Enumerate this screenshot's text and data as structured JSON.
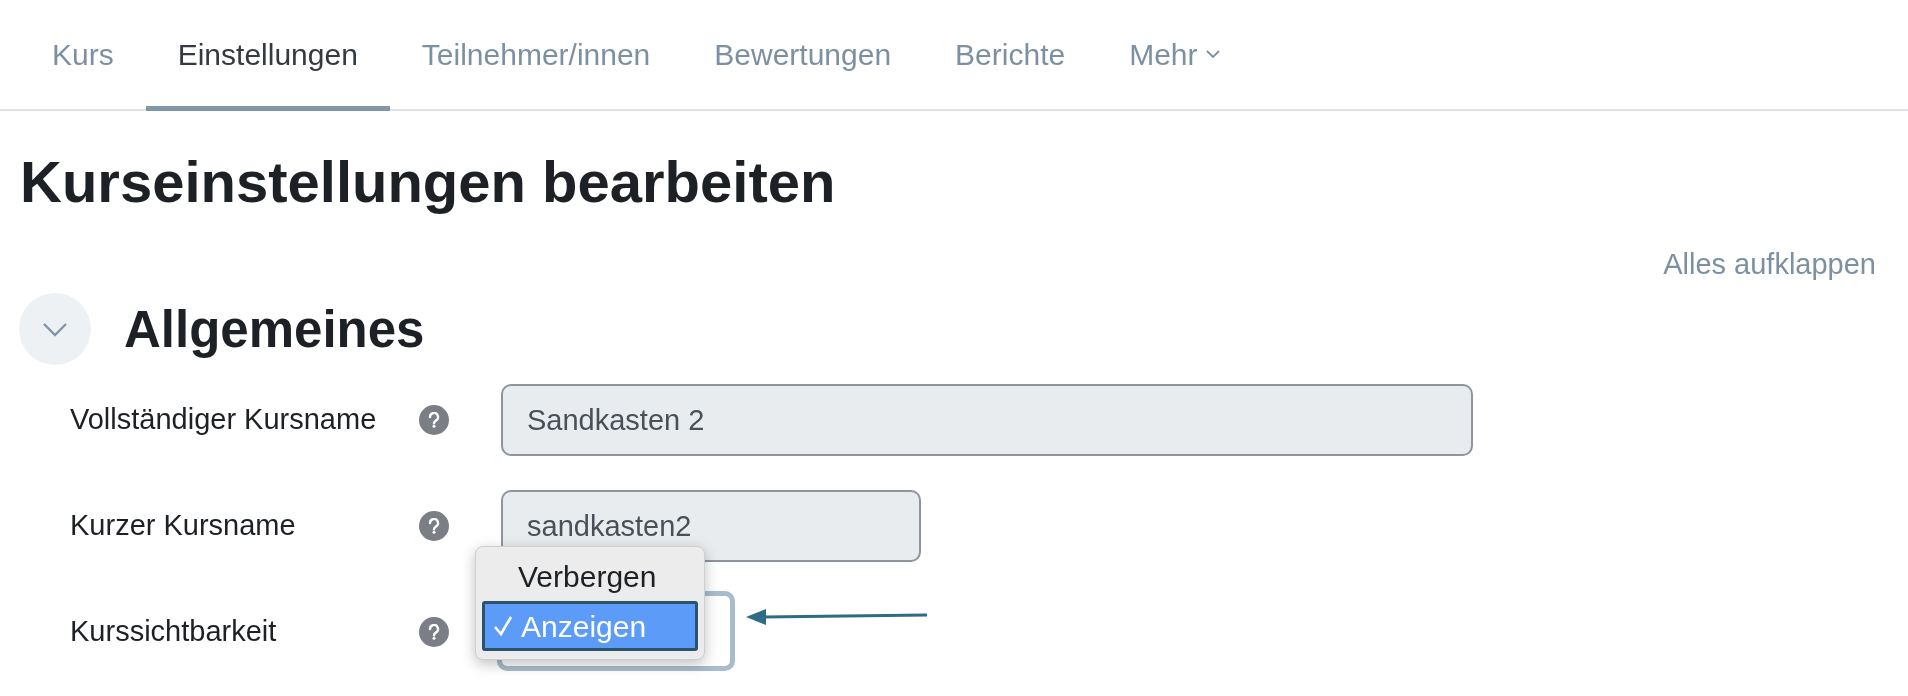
{
  "tabs": [
    {
      "label": "Kurs",
      "selected": false
    },
    {
      "label": "Einstellungen",
      "selected": true
    },
    {
      "label": "Teilnehmer/innen",
      "selected": false
    },
    {
      "label": "Bewertungen",
      "selected": false
    },
    {
      "label": "Berichte",
      "selected": false
    },
    {
      "label": "Mehr",
      "selected": false,
      "kind": "menu"
    }
  ],
  "page_title": "Kurseinstellungen bearbeiten",
  "expand_all": "Alles aufklappen",
  "section": {
    "title": "Allgemeines",
    "expanded": true
  },
  "fields": [
    {
      "label": "Vollständiger Kursname",
      "kind": "text",
      "value": "Sandkasten 2"
    },
    {
      "label": "Kurzer Kursname",
      "kind": "text",
      "value": "sandkasten2"
    },
    {
      "label": "Kurssichtbarkeit",
      "kind": "select",
      "options": [
        {
          "label": "Verbergen",
          "selected": false
        },
        {
          "label": "Anzeigen",
          "selected": true
        }
      ]
    }
  ]
}
